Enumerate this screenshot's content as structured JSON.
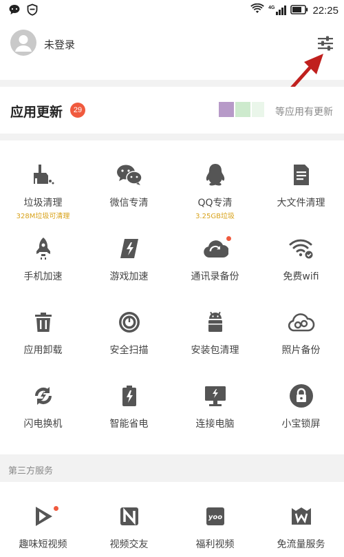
{
  "status_bar": {
    "time": "22:25",
    "network": "4G",
    "icons": [
      "message-icon",
      "shield-icon",
      "wifi-icon",
      "signal-icon",
      "battery-icon"
    ]
  },
  "header": {
    "login_text": "未登录",
    "settings_icon": "settings-sliders-icon"
  },
  "app_update": {
    "title": "应用更新",
    "badge": "29",
    "note": "等应用有更新"
  },
  "tools": [
    {
      "label": "垃圾清理",
      "sub": "328M垃圾可清理",
      "icon": "broom-icon"
    },
    {
      "label": "微信专清",
      "sub": "",
      "icon": "wechat-icon"
    },
    {
      "label": "QQ专清",
      "sub": "3.25GB垃圾",
      "icon": "penguin-icon"
    },
    {
      "label": "大文件清理",
      "sub": "",
      "icon": "document-icon"
    },
    {
      "label": "手机加速",
      "sub": "",
      "icon": "rocket-icon"
    },
    {
      "label": "游戏加速",
      "sub": "",
      "icon": "game-boost-icon"
    },
    {
      "label": "通讯录备份",
      "sub": "",
      "icon": "cloud-sync-icon"
    },
    {
      "label": "免费wifi",
      "sub": "",
      "icon": "wifi-check-icon"
    },
    {
      "label": "应用卸载",
      "sub": "",
      "icon": "trash-icon"
    },
    {
      "label": "安全扫描",
      "sub": "",
      "icon": "scan-icon"
    },
    {
      "label": "安装包清理",
      "sub": "",
      "icon": "android-icon"
    },
    {
      "label": "照片备份",
      "sub": "",
      "icon": "cloud-icon"
    },
    {
      "label": "闪电换机",
      "sub": "",
      "icon": "lightning-swap-icon"
    },
    {
      "label": "智能省电",
      "sub": "",
      "icon": "battery-bolt-icon"
    },
    {
      "label": "连接电脑",
      "sub": "",
      "icon": "monitor-bolt-icon"
    },
    {
      "label": "小宝锁屏",
      "sub": "",
      "icon": "lock-icon"
    }
  ],
  "third_party": {
    "title": "第三方服务",
    "items": [
      {
        "label": "趣味短视频",
        "icon": "play-icon"
      },
      {
        "label": "视频交友",
        "icon": "n-logo-icon"
      },
      {
        "label": "福利视频",
        "icon": "yoo-logo-icon",
        "logo_text": "yoo"
      },
      {
        "label": "免流量服务",
        "icon": "crown-w-icon"
      }
    ]
  },
  "colors": {
    "accent_red": "#f05a3e",
    "sub_yellow": "#d8a21a",
    "icon_gray": "#555555",
    "annotation_red": "#c0201e"
  }
}
